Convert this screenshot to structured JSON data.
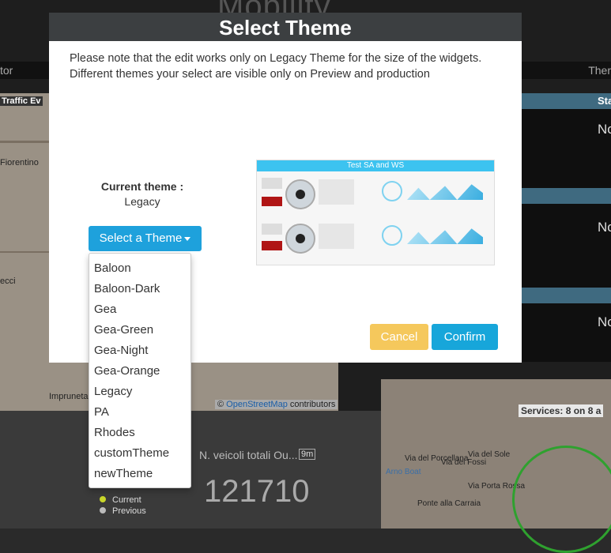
{
  "background": {
    "title": "Mobility",
    "toolbar_left": "tor",
    "toolbar_right": "Ther",
    "map_labels": [
      "Traffic Ev",
      "Fiorentino",
      "Impruneta",
      "ecci"
    ],
    "right_panel_values": [
      "No",
      "No",
      "No"
    ],
    "right_panel_header": "Sta",
    "osm_prefix": "©",
    "osm_link": "OpenStreetMap",
    "osm_suffix": "contributors",
    "widget_label": "N. veicoli totali Ou...",
    "widget_time": "9m",
    "big_number": "121710",
    "legend_current": "Current",
    "legend_previous": "Previous",
    "services_label": "Services: 8 on 8 a",
    "map_right_labels": [
      "Via del Porcellana",
      "Via dei Fossi",
      "Via del Sole",
      "Via Porta Rossa",
      "Ponte alla Carraia",
      "Arno Boat"
    ]
  },
  "modal": {
    "title": "Select Theme",
    "note": "Please note that the edit works only on Legacy Theme for the size of the widgets. Different themes your select are visible only on Preview and production",
    "current_theme_label": "Current theme :",
    "current_theme_value": "Legacy",
    "select_button_label": "Select a Theme",
    "preview_title": "Test SA and WS",
    "cancel_label": "Cancel",
    "confirm_label": "Confirm",
    "theme_options": [
      "Baloon",
      "Baloon-Dark",
      "Gea",
      "Gea-Green",
      "Gea-Night",
      "Gea-Orange",
      "Legacy",
      "PA",
      "Rhodes",
      "customTheme",
      "newTheme"
    ]
  },
  "colors": {
    "header": "#3c3f41",
    "select_button": "#1ea1dc",
    "cancel_button": "#f5c85c",
    "confirm_button": "#17a6da"
  }
}
